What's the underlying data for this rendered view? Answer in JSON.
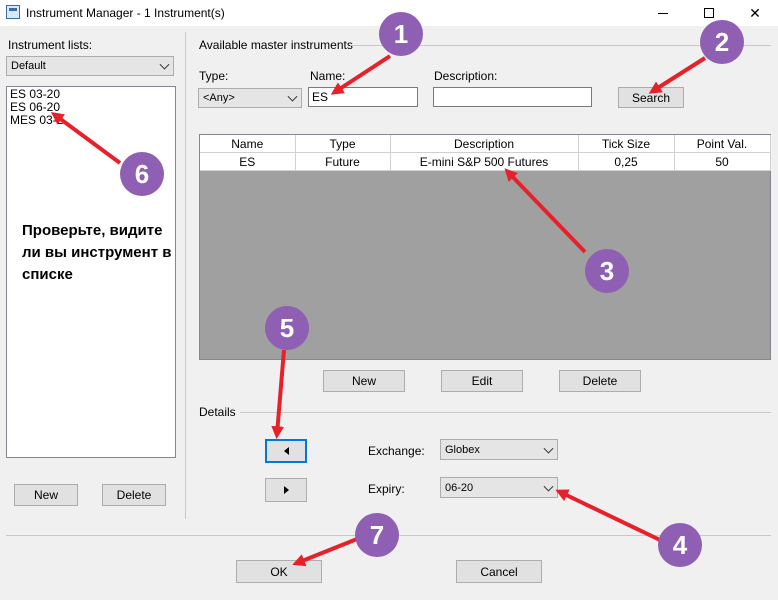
{
  "window": {
    "title": "Instrument Manager - 1 Instrument(s)",
    "minimize": "minimize",
    "maximize": "maximize",
    "close": "✕"
  },
  "left_panel": {
    "lists_label": "Instrument lists:",
    "selected_list": "Default",
    "items": [
      "ES 03-20",
      "ES 06-20",
      "MES 03-2"
    ],
    "new_label": "New",
    "delete_label": "Delete"
  },
  "master": {
    "group_label": "Available master instruments",
    "type_label": "Type:",
    "type_value": "<Any>",
    "name_label": "Name:",
    "name_value": "ES",
    "description_label": "Description:",
    "description_value": "",
    "search_label": "Search",
    "columns": [
      "Name",
      "Type",
      "Description",
      "Tick Size",
      "Point Val."
    ],
    "rows": [
      [
        "ES",
        "Future",
        "E-mini S&P 500 Futures",
        "0,25",
        "50"
      ]
    ],
    "new_label": "New",
    "edit_label": "Edit",
    "delete_label": "Delete"
  },
  "details": {
    "group_label": "Details",
    "exchange_label": "Exchange:",
    "exchange_value": "Globex",
    "expiry_label": "Expiry:",
    "expiry_value": "06-20"
  },
  "footer": {
    "ok_label": "OK",
    "cancel_label": "Cancel"
  },
  "annotations": {
    "note": "Проверьте, видите ли вы инструмент в списке",
    "badges": [
      "1",
      "2",
      "3",
      "4",
      "5",
      "6",
      "7"
    ],
    "badge_color": "#8e5fb2",
    "arrow_color": "#e8202a"
  }
}
